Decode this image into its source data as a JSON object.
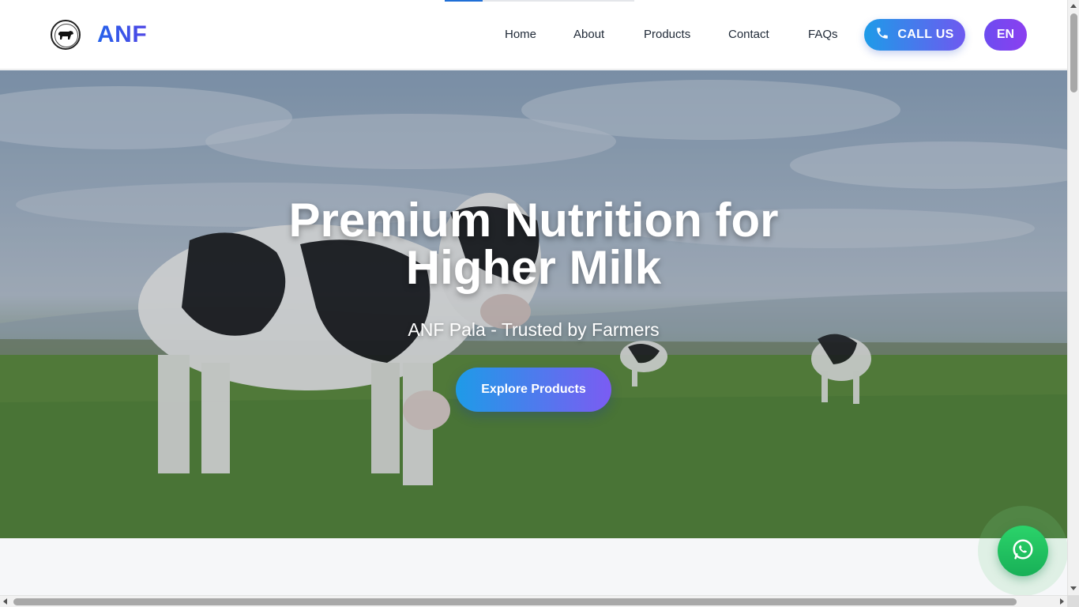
{
  "brand": {
    "name": "ANF",
    "logo_icon": "cow-emblem-icon"
  },
  "nav": {
    "items": [
      {
        "label": "Home"
      },
      {
        "label": "About"
      },
      {
        "label": "Products"
      },
      {
        "label": "Contact"
      },
      {
        "label": "FAQs"
      }
    ],
    "call_label": "CALL US",
    "call_icon": "phone-icon",
    "lang_label": "EN"
  },
  "hero": {
    "title": "Premium Nutrition for Higher Milk",
    "subtitle": "ANF Pala - Trusted by Farmers",
    "cta_label": "Explore Products"
  },
  "floating": {
    "whatsapp_icon": "whatsapp-icon"
  },
  "colors": {
    "brand_blue": "#2563eb",
    "gradient_start": "#1e9be8",
    "gradient_end": "#7b5cf2",
    "whatsapp_green": "#1fbf5f"
  }
}
